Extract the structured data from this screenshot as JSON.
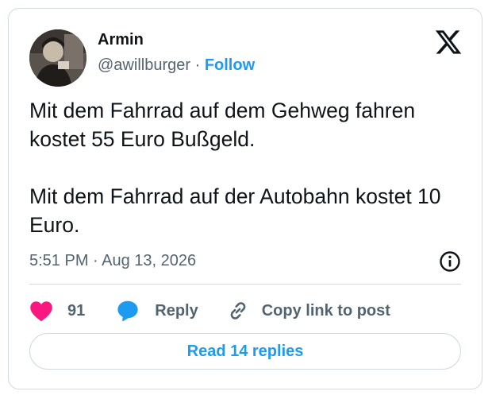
{
  "author": {
    "name": "Armin",
    "handle": "@awillburger",
    "separator": "·",
    "follow_label": "Follow"
  },
  "tweet": {
    "paragraphs": [
      "Mit dem Fahrrad auf dem Gehweg fahren kostet 55 Euro Bußgeld.",
      "Mit dem Fahrrad auf der Autobahn kostet 10 Euro."
    ],
    "timestamp": "5:51 PM · Aug 13, 2026"
  },
  "actions": {
    "like_count": "91",
    "reply_label": "Reply",
    "copy_label": "Copy link to post"
  },
  "read_replies_label": "Read 14 replies",
  "icons": {
    "brand": "x-logo-icon",
    "info": "info-icon",
    "like": "heart-icon",
    "reply": "speech-bubble-icon",
    "copy": "link-icon"
  },
  "colors": {
    "accent": "#1d9bf0",
    "like": "#f91880",
    "text": "#0f1419",
    "secondary": "#536471",
    "border": "#cfd9de"
  }
}
